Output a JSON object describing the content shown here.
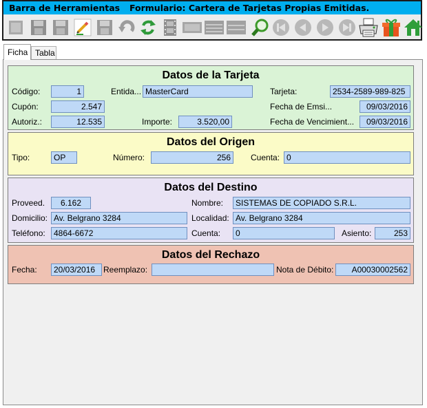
{
  "toolbar": {
    "title": "Barra de Herramientas",
    "form_title": "Formulario: Cartera de Tarjetas Propias Emitidas.",
    "icons": [
      "new-icon",
      "save-icon",
      "save-all-icon",
      "edit-pencil-icon",
      "save-disabled-icon",
      "undo-icon",
      "refresh-icon",
      "film-icon",
      "card-icon",
      "list-icon",
      "grid-icon",
      "search-icon",
      "first-record-icon",
      "previous-record-icon",
      "next-record-icon",
      "last-record-icon",
      "print-icon",
      "gift-icon",
      "home-icon"
    ]
  },
  "tabs": [
    "Ficha",
    "Tabla"
  ],
  "tarjeta": {
    "title": "Datos de la Tarjeta",
    "codigo_label": "Código:",
    "codigo": "1",
    "entidad_label": "Entida...",
    "entidad": "MasterCard",
    "tarjeta_label": "Tarjeta:",
    "tarjeta": "2534-2589-989-825",
    "cupon_label": "Cupón:",
    "cupon": "2.547",
    "fecha_emision_label": "Fecha de Emsi...",
    "fecha_emision": "09/03/2016",
    "autoriz_label": "Autoriz.:",
    "autoriz": "12.535",
    "importe_label": "Importe:",
    "importe": "3.520,00",
    "fecha_venc_label": "Fecha de Vencimient...",
    "fecha_venc": "09/03/2016"
  },
  "origen": {
    "title": "Datos del Origen",
    "tipo_label": "Tipo:",
    "tipo": "OP",
    "numero_label": "Número:",
    "numero": "256",
    "cuenta_label": "Cuenta:",
    "cuenta": "0"
  },
  "destino": {
    "title": "Datos del Destino",
    "proveed_label": "Proveed.",
    "proveed": "6.162",
    "nombre_label": "Nombre:",
    "nombre": "SISTEMAS DE COPIADO S.R.L.",
    "domicilio_label": "Domicilio:",
    "domicilio": "Av. Belgrano 3284",
    "localidad_label": "Localidad:",
    "localidad": "Av. Belgrano 3284",
    "telefono_label": "Teléfono:",
    "telefono": "4864-6672",
    "cuenta_label": "Cuenta:",
    "cuenta": "0",
    "asiento_label": "Asiento:",
    "asiento": "253"
  },
  "rechazo": {
    "title": "Datos del Rechazo",
    "fecha_label": "Fecha:",
    "fecha": "20/03/2016",
    "reemplazo_label": "Reemplazo:",
    "reemplazo": "",
    "nota_label": "Nota de Débito:",
    "nota": "A00030002562"
  }
}
